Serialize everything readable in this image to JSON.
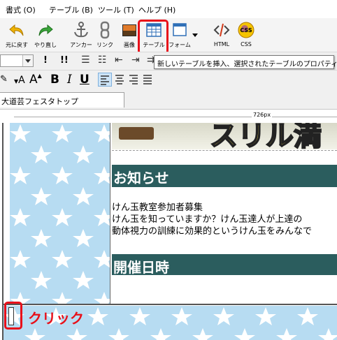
{
  "menu": {
    "items": [
      "書式 (O)",
      "テーブル (B)",
      "ツール (T)",
      "ヘルプ (H)"
    ]
  },
  "toolbar": {
    "undo_label": "元に戻す",
    "redo_label": "やり直し",
    "anchor_label": "アンカー",
    "link_label": "リンク",
    "image_label": "画像",
    "table_label": "テーブル",
    "form_label": "フォーム",
    "html_label": "HTML",
    "css_label": "CSS",
    "css_icon_text": "CSS",
    "tooltip": "新しいテーブルを挿入、選択されたテーブルのプロパティ"
  },
  "format": {
    "bang1": "!",
    "bang2": "!!",
    "bold": "B",
    "italic": "I",
    "underline": "U",
    "font_up": "A",
    "font_down": "A"
  },
  "tabs": {
    "document": "大道芸フェスタトップ"
  },
  "ruler": {
    "width_label": "726px"
  },
  "page": {
    "banner_text": "スリル満",
    "notice_heading": "お知らせ",
    "notice_lines": [
      "けん玉教室参加者募集",
      "けん玉を知っていますか？けん玉達人が上達の",
      "動体視力の訓練に効果的というけん玉をみんなで"
    ],
    "event_heading": "開催日時"
  },
  "annotation": {
    "click_label": "クリック"
  },
  "colors": {
    "highlight_red": "#e8101a",
    "heading_bg": "#2b5d5e",
    "star_bg": "#b7dcf2"
  }
}
